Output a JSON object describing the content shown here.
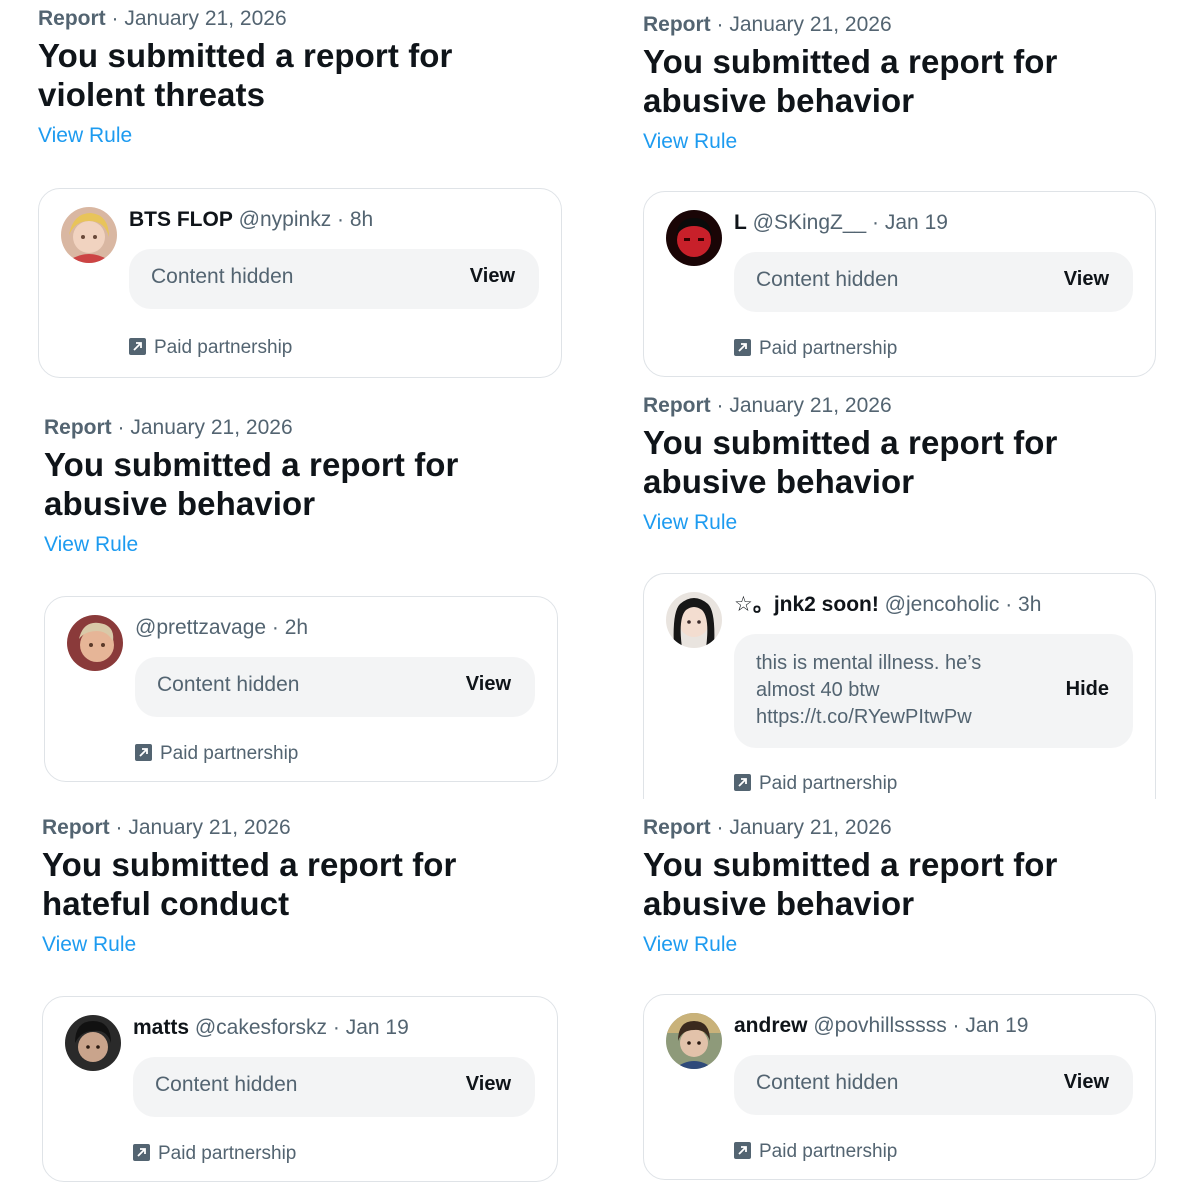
{
  "icons": {
    "avatar": "user-avatar",
    "paid": "arrow-up-right-square-icon"
  },
  "colors": {
    "link": "#1d9bf0",
    "muted": "#536471",
    "text": "#0f1419",
    "pill": "#f3f4f5"
  },
  "reports": [
    {
      "meta_kind": "Report",
      "meta_date": " · January 21, 2026",
      "title_line1": "You submitted a report for",
      "title_line2": "violent threats",
      "rule": "View Rule",
      "post": {
        "name": "BTS FLOP",
        "handle": " @nypinkz",
        "time": " · 8h",
        "hidden": "Content hidden",
        "action": "View",
        "paid": "Paid partnership"
      }
    },
    {
      "meta_kind": "Report",
      "meta_date": " · January 21, 2026",
      "title_line1": "You submitted a report for",
      "title_line2": "abusive behavior",
      "rule": "View Rule",
      "post": {
        "name": "L",
        "handle": " @SKingZ__",
        "time": " · Jan 19",
        "hidden": "Content hidden",
        "action": "View",
        "paid": "Paid partnership"
      }
    },
    {
      "meta_kind": "Report",
      "meta_date": " · January 21, 2026",
      "title_line1": "You submitted a report for",
      "title_line2": "abusive behavior",
      "rule": "View Rule",
      "post": {
        "name": "",
        "handle": "@prettzavage",
        "time": " · 2h",
        "hidden": "Content hidden",
        "action": "View",
        "paid": "Paid partnership"
      }
    },
    {
      "meta_kind": "Report",
      "meta_date": " · January 21, 2026",
      "title_line1": "You submitted a report for",
      "title_line2": "abusive behavior",
      "rule": "View Rule",
      "post": {
        "name": "☆。jnk2 soon!",
        "handle": " @jencoholic",
        "time": " · 3h",
        "text_line1": "this is mental illness. he’s",
        "text_line2": "almost 40 btw",
        "text_line3": "https://t.co/RYewPItwPw",
        "action": "Hide",
        "paid": "Paid partnership"
      }
    },
    {
      "meta_kind": "Report",
      "meta_date": " · January 21, 2026",
      "title_line1": "You submitted a report for",
      "title_line2": "hateful conduct",
      "rule": "View Rule",
      "post": {
        "name": "matts",
        "handle": " @cakesforskz",
        "time": " · Jan 19",
        "hidden": "Content hidden",
        "action": "View",
        "paid": "Paid partnership"
      }
    },
    {
      "meta_kind": "Report",
      "meta_date": " · January 21, 2026",
      "title_line1": "You submitted a report for",
      "title_line2": "abusive behavior",
      "rule": "View Rule",
      "post": {
        "name": "andrew",
        "handle": " @povhillsssss",
        "time": " · Jan 19",
        "hidden": "Content hidden",
        "action": "View",
        "paid": "Paid partnership"
      }
    }
  ]
}
